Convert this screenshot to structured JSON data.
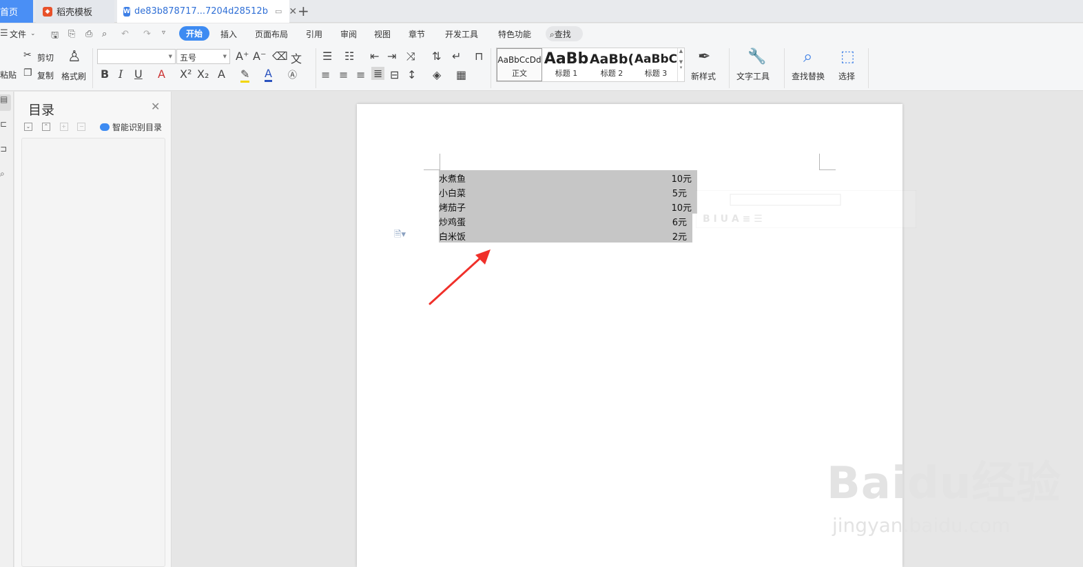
{
  "tabs": {
    "home": "首页",
    "template": "稻壳模板",
    "document": "de83b878717...7204d28512b"
  },
  "menu": {
    "file": "文件",
    "items": [
      "开始",
      "插入",
      "页面布局",
      "引用",
      "审阅",
      "视图",
      "章节",
      "开发工具",
      "特色功能"
    ],
    "find": "查找"
  },
  "ribbon": {
    "paste": "粘贴",
    "cut": "剪切",
    "copy": "复制",
    "format_painter": "格式刷",
    "font_name": "",
    "font_size": "五号",
    "styles": [
      {
        "preview": "AaBbCcDd",
        "label": "正文"
      },
      {
        "preview": "AaBb",
        "label": "标题 1"
      },
      {
        "preview": "AaBb(",
        "label": "标题 2"
      },
      {
        "preview": "AaBbC",
        "label": "标题 3"
      }
    ],
    "new_style": "新样式",
    "text_tools": "文字工具",
    "find_replace": "查找替换",
    "select": "选择"
  },
  "toc": {
    "title": "目录",
    "smart": "智能识别目录"
  },
  "document": {
    "rows": [
      {
        "name": "水煮鱼",
        "price": "10元"
      },
      {
        "name": "小白菜",
        "price": "5元"
      },
      {
        "name": "烤茄子",
        "price": "10元"
      },
      {
        "name": "炒鸡蛋",
        "price": "6元"
      },
      {
        "name": "白米饭",
        "price": "2元"
      }
    ]
  },
  "watermark": {
    "brand": "Baidu经验",
    "url": "jingyan.baidu.com"
  }
}
